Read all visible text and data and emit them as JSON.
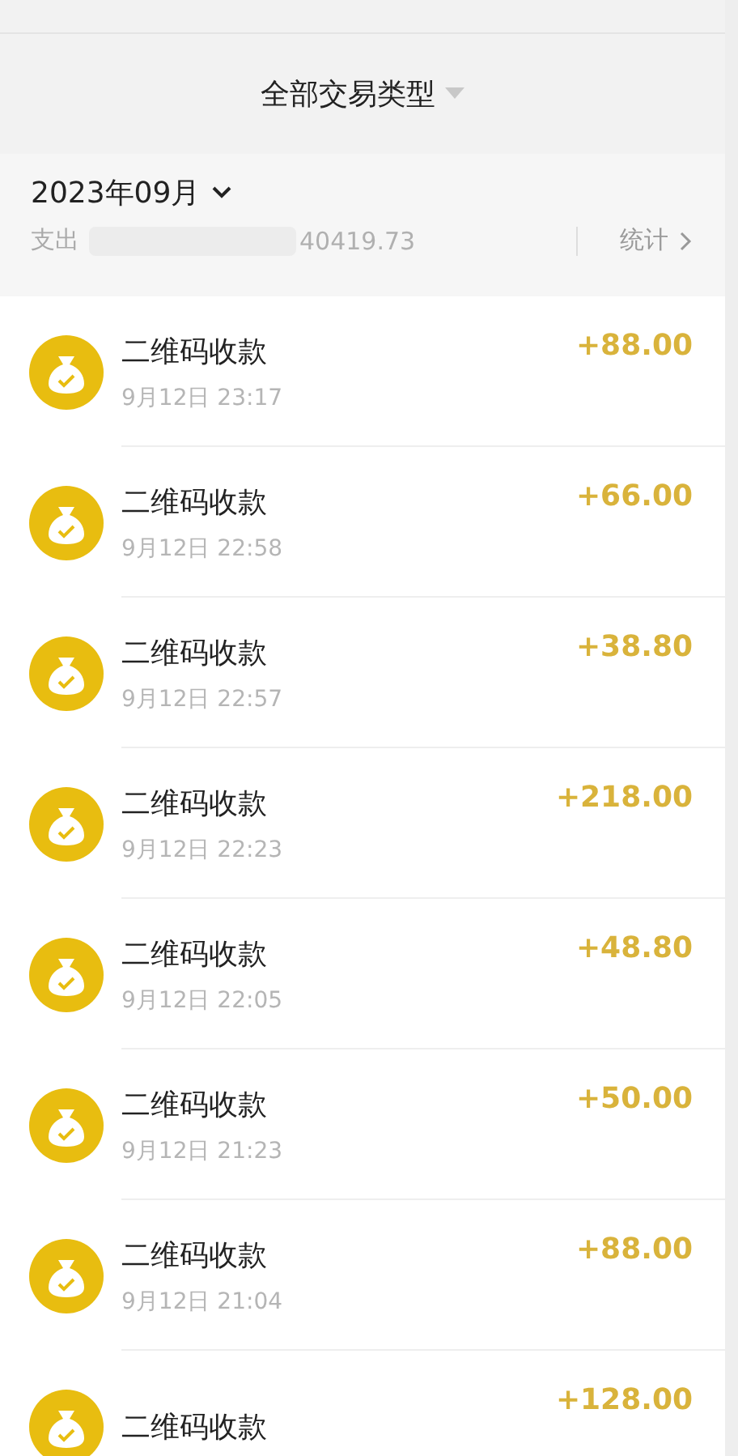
{
  "filter": {
    "label": "全部交易类型"
  },
  "month": {
    "label": "2023年09月",
    "expense_label": "支出",
    "expense_amount": "40419.73",
    "stats_link": "统计"
  },
  "transactions": [
    {
      "title": "二维码收款",
      "time": "9月12日 23:17",
      "amount": "+88.00"
    },
    {
      "title": "二维码收款",
      "time": "9月12日 22:58",
      "amount": "+66.00"
    },
    {
      "title": "二维码收款",
      "time": "9月12日 22:57",
      "amount": "+38.80"
    },
    {
      "title": "二维码收款",
      "time": "9月12日 22:23",
      "amount": "+218.00"
    },
    {
      "title": "二维码收款",
      "time": "9月12日 22:05",
      "amount": "+48.80"
    },
    {
      "title": "二维码收款",
      "time": "9月12日 21:23",
      "amount": "+50.00"
    },
    {
      "title": "二维码收款",
      "time": "9月12日 21:04",
      "amount": "+88.00"
    },
    {
      "title": "二维码收款",
      "amount": "+128.00"
    }
  ]
}
